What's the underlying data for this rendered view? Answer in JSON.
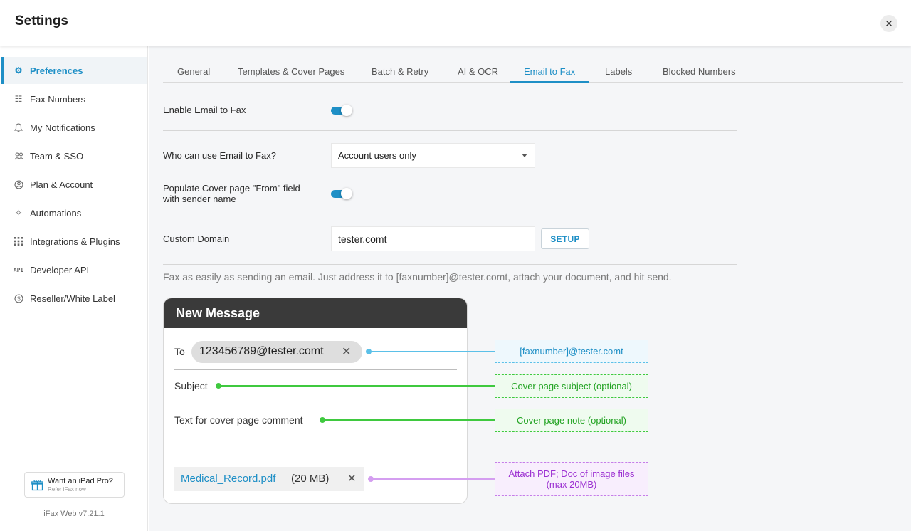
{
  "window": {
    "title": "Settings",
    "close_glyph": "✕"
  },
  "sidebar": {
    "items": [
      {
        "label": "Preferences",
        "icon": "gear-icon",
        "glyph": "⚙",
        "active": true
      },
      {
        "label": "Fax Numbers",
        "icon": "keypad-icon",
        "glyph": "☷"
      },
      {
        "label": "My Notifications",
        "icon": "bell-icon",
        "glyph": "♫"
      },
      {
        "label": "Team & SSO",
        "icon": "team-icon",
        "glyph": "⚇"
      },
      {
        "label": "Plan & Account",
        "icon": "account-icon",
        "glyph": "◉"
      },
      {
        "label": "Automations",
        "icon": "sparkle-icon",
        "glyph": "✧"
      },
      {
        "label": "Integrations & Plugins",
        "icon": "grid-icon",
        "glyph": "⁞⁞"
      },
      {
        "label": "Developer API",
        "icon": "api-icon",
        "glyph": "API"
      },
      {
        "label": "Reseller/White Label",
        "icon": "dollar-icon",
        "glyph": "$"
      }
    ],
    "promo": {
      "title": "Want an iPad Pro?",
      "subtitle": "Refer iFax now",
      "icon": "gift-icon"
    },
    "version": "iFax Web v7.21.1"
  },
  "tabs": [
    {
      "label": "General"
    },
    {
      "label": "Templates & Cover Pages"
    },
    {
      "label": "Batch & Retry"
    },
    {
      "label": "AI & OCR"
    },
    {
      "label": "Email to Fax",
      "active": true
    },
    {
      "label": "Labels"
    },
    {
      "label": "Blocked Numbers"
    }
  ],
  "settings": {
    "enable_label": "Enable Email to Fax",
    "enable_on": true,
    "who_label": "Who can use Email to Fax?",
    "who_value": "Account users only",
    "populate_label_line1": "Populate Cover page \"From\" field",
    "populate_label_line2": "with sender name",
    "populate_on": true,
    "domain_label": "Custom Domain",
    "domain_value": "tester.comt",
    "setup_label": "SETUP",
    "help_text": "Fax as easily as sending an email. Just address it to [faxnumber]@tester.comt, attach your document, and hit send."
  },
  "message": {
    "header": "New Message",
    "to_label": "To",
    "to_value": "123456789@tester.comt",
    "chip_close": "✕",
    "subject_label": "Subject",
    "comment_label": "Text for cover page comment",
    "attachment_name": "Medical_Record.pdf",
    "attachment_size": "(20 MB)",
    "attachment_close": "✕"
  },
  "callouts": {
    "to": "[faxnumber]@tester.comt",
    "subject": "Cover page subject (optional)",
    "note": "Cover page note (optional)",
    "attach_line1": "Attach PDF; Doc of image files",
    "attach_line2": "(max 20MB)"
  },
  "colors": {
    "accent": "#1e8fc6",
    "to": "#5bc0e8",
    "subject": "#3fc93f",
    "note": "#3fc93f",
    "attach": "#d49ef0"
  }
}
